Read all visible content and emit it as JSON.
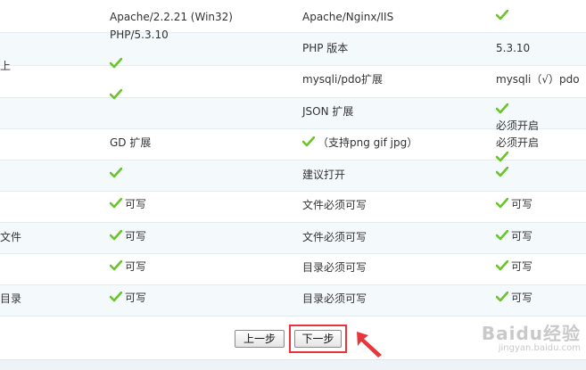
{
  "rows": [
    {
      "c0": "",
      "c1": "Apache/2.2.21 (Win32)",
      "c1b": "PHP/5.3.10",
      "c2": "Apache/Nginx/IIS",
      "c3_check": true
    },
    {
      "c0": "上",
      "c1_check": true,
      "c2": "PHP 版本",
      "c3": "5.3.10"
    },
    {
      "c1_check": true,
      "c2": "mysqli/pdo扩展",
      "c3": "mysqli（√）pdo"
    },
    {
      "c2": "JSON 扩展",
      "c3_check": true,
      "c3b": "必须开启"
    },
    {
      "c1": "GD 扩展",
      "c2_check": true,
      "c2_after": "（支持png gif jpg）",
      "c3": "必须开启"
    },
    {
      "c1_check": true,
      "c2": "建议打开",
      "c3_check": true
    },
    {
      "c1_check": true,
      "c1_label": "可写",
      "c2": "文件必须可写",
      "c3_check": true,
      "c3_label": "可写"
    },
    {
      "c0": "文件",
      "c1_check": true,
      "c1_label": "可写",
      "c2": "文件必须可写",
      "c3_check": true,
      "c3_label": "可写"
    },
    {
      "c1_check": true,
      "c1_label": "可写",
      "c2": "目录必须可写",
      "c3_check": true,
      "c3_label": "可写"
    },
    {
      "c0": "目录",
      "c1_check": true,
      "c1_label": "可写",
      "c2": "目录必须可写",
      "c3_check": true,
      "c3_label": "可写"
    }
  ],
  "buttons": {
    "prev": "上一步",
    "next": "下一步"
  },
  "watermark": {
    "main": "Baidu经验",
    "sub": "jingyan.baidu.com"
  },
  "colors": {
    "check": "#6ac42a",
    "highlight": "#e8343a",
    "arrow": "#e8343a"
  }
}
